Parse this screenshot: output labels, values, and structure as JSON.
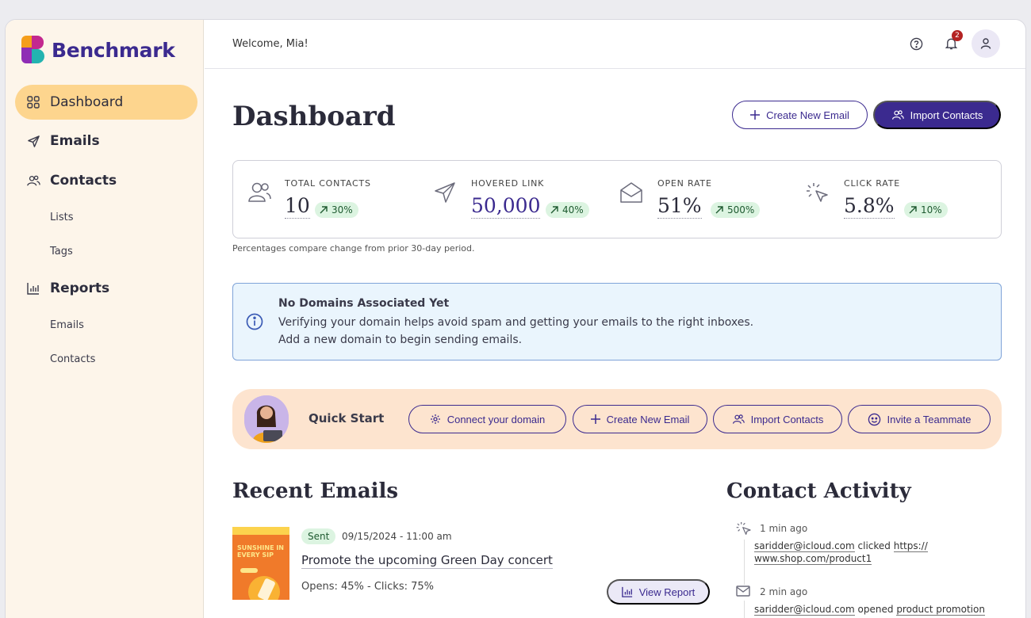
{
  "app": {
    "name": "Benchmark"
  },
  "sidebar": {
    "items": [
      {
        "label": "Dashboard",
        "icon": "grid-icon",
        "active": true
      },
      {
        "label": "Emails",
        "icon": "send-icon"
      },
      {
        "label": "Contacts",
        "icon": "people-icon"
      },
      {
        "label": "Lists",
        "sub": true
      },
      {
        "label": "Tags",
        "sub": true
      },
      {
        "label": "Reports",
        "icon": "bar-chart-icon"
      },
      {
        "label": "Emails",
        "sub": true
      },
      {
        "label": "Contacts",
        "sub": true
      }
    ]
  },
  "header": {
    "welcome": "Welcome, Mia!",
    "notification_count": "2"
  },
  "page": {
    "title": "Dashboard",
    "create_email_label": "Create New Email",
    "import_contacts_label": "Import Contacts"
  },
  "stats": [
    {
      "label": "TOTAL CONTACTS",
      "value": "10",
      "change": "30%",
      "icon": "people-icon"
    },
    {
      "label": "HOVERED LINK",
      "value": "50,000",
      "change": "40%",
      "icon": "send-icon"
    },
    {
      "label": "OPEN RATE",
      "value": "51%",
      "change": "500%",
      "icon": "envelope-open-icon"
    },
    {
      "label": "CLICK RATE",
      "value": "5.8%",
      "change": "10%",
      "icon": "cursor-click-icon"
    }
  ],
  "stats_footnote": "Percentages compare change from prior 30-day period.",
  "alert": {
    "title": "No Domains Associated Yet",
    "line1": "Verifying your domain helps avoid spam and getting your emails to the right inboxes.",
    "line2": "Add a new domain to begin sending emails."
  },
  "quick_start": {
    "label": "Quick Start",
    "buttons": [
      {
        "label": "Connect your domain",
        "icon": "gear-icon"
      },
      {
        "label": "Create New Email",
        "icon": "plus-icon"
      },
      {
        "label": "Import Contacts",
        "icon": "people-icon"
      },
      {
        "label": "Invite a Teammate",
        "icon": "smiley-icon"
      }
    ]
  },
  "recent_emails": {
    "title": "Recent Emails",
    "items": [
      {
        "status": "Sent",
        "date": "09/15/2024 - 11:00 am",
        "subject": "Promote the upcoming Green Day concert",
        "stats": "Opens: 45% - Clicks: 75%",
        "thumb_text": "SUNSHINE IN EVERY SIP",
        "action": "View Report"
      }
    ]
  },
  "contact_activity": {
    "title": "Contact Activity",
    "items": [
      {
        "time": "1 min ago",
        "email": "saridder@icloud.com",
        "action": "clicked",
        "target": "https:// www.shop.com/product1",
        "icon": "cursor-click-icon"
      },
      {
        "time": "2 min ago",
        "email": "saridder@icloud.com",
        "action": "opened",
        "target": "product promotion",
        "icon": "envelope-icon"
      }
    ]
  },
  "colors": {
    "brand": "#3b2a8f",
    "sidebar_bg": "#fdf5ea",
    "active_nav": "#fdd58e",
    "alert_bg": "#eaf5fd",
    "quick_start_bg": "#fde4cf",
    "positive": "#dcf4e1"
  }
}
